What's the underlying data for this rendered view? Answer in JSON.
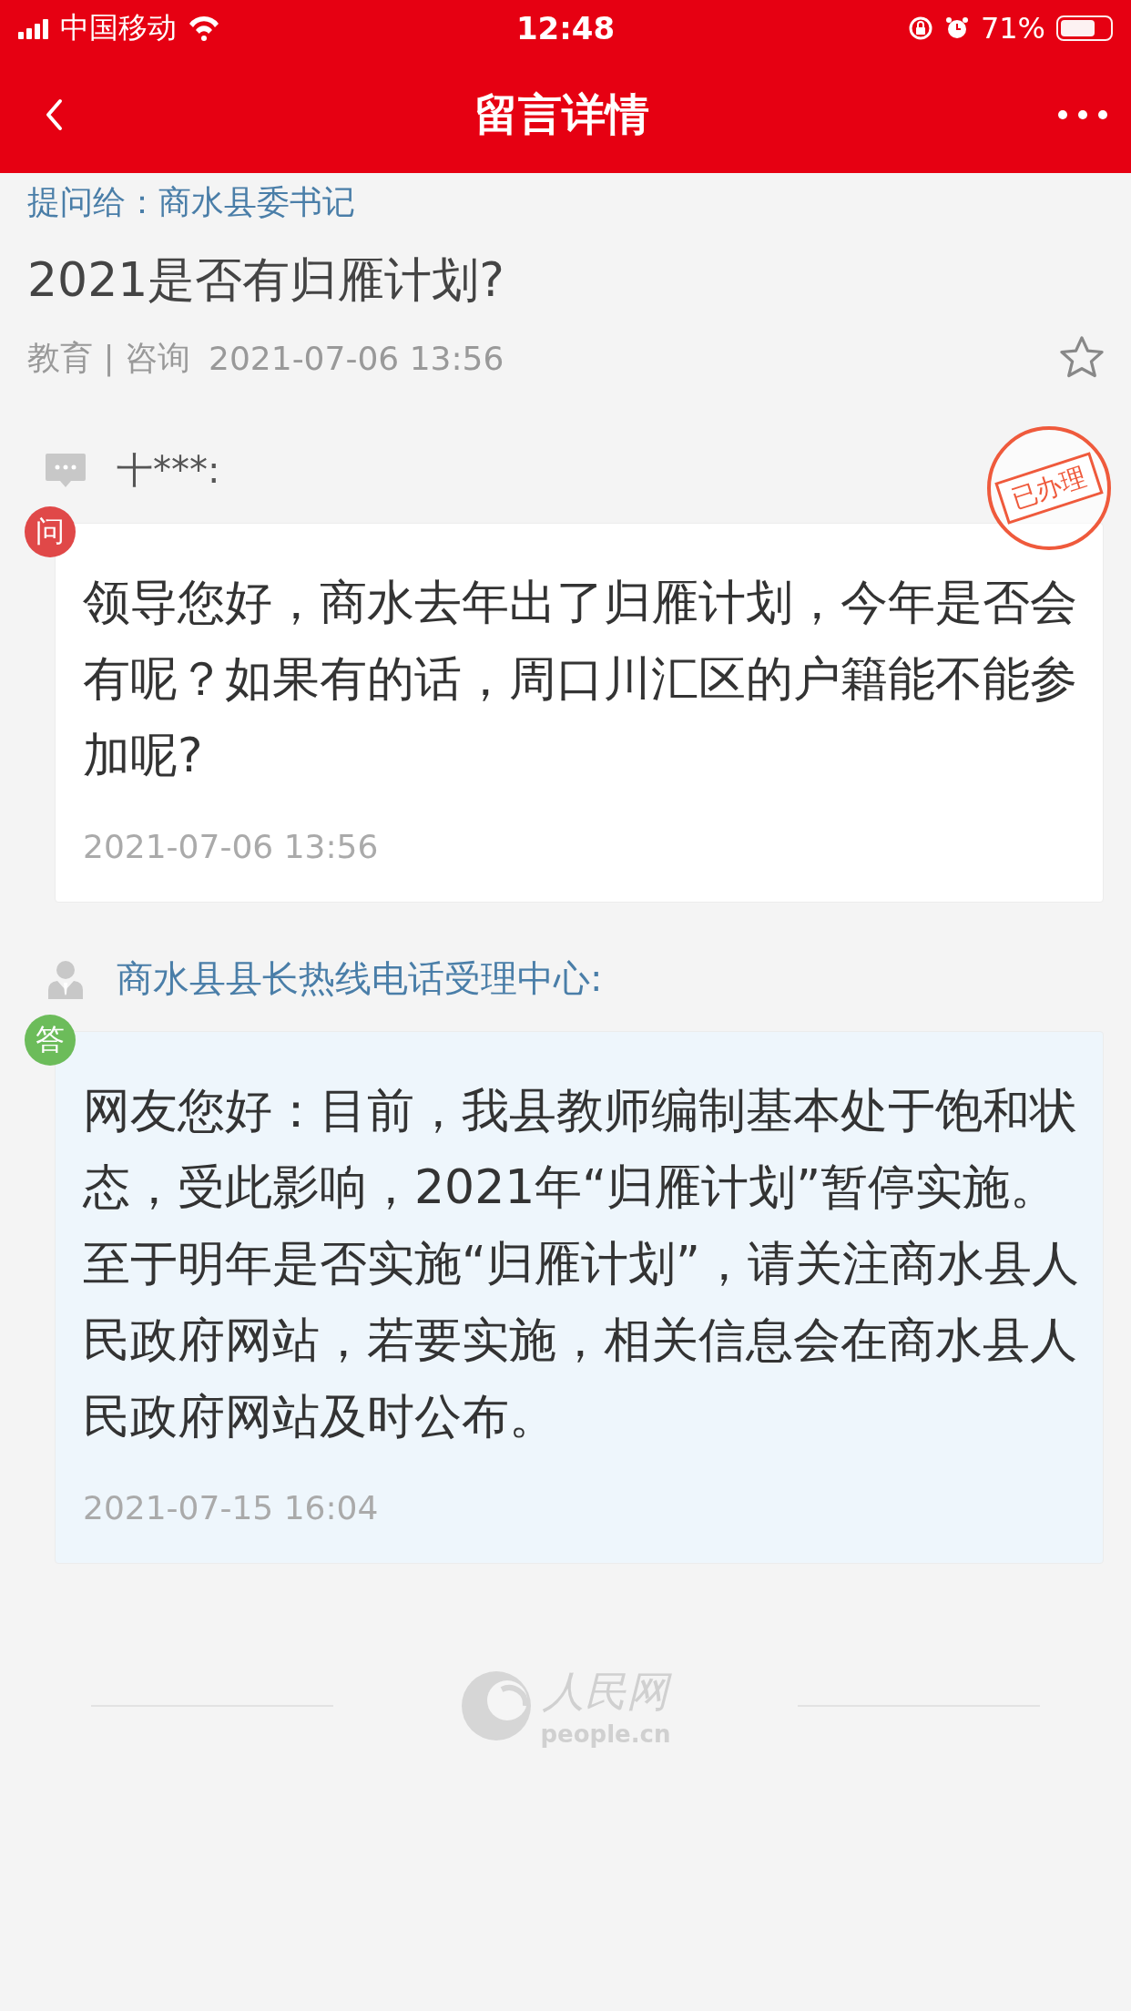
{
  "status_bar": {
    "carrier": "中国移动",
    "time": "12:48",
    "battery": "71%"
  },
  "header": {
    "title": "留言详情"
  },
  "recipient": "提问给：商水县委书记",
  "message": {
    "title": "2021是否有归雁计划?",
    "category": "教育 | 咨询",
    "date": "2021-07-06 13:56",
    "starred": false
  },
  "question": {
    "badge": "问",
    "author": "十***:",
    "stamp": "已办理",
    "text": "领导您好，商水去年出了归雁计划，今年是否会有呢？如果有的话，周口川汇区的户籍能不能参加呢?",
    "date": "2021-07-06 13:56"
  },
  "answer": {
    "badge": "答",
    "author": "商水县县长热线电话受理中心:",
    "text": "网友您好：目前，我县教师编制基本处于饱和状态，受此影响，2021年“归雁计划”暂停实施。至于明年是否实施“归雁计划”，请关注商水县人民政府网站，若要实施，相关信息会在商水县人民政府网站及时公布。",
    "date": "2021-07-15 16:04"
  },
  "footer": {
    "logo_text": "人民网",
    "domain": "people.cn"
  }
}
